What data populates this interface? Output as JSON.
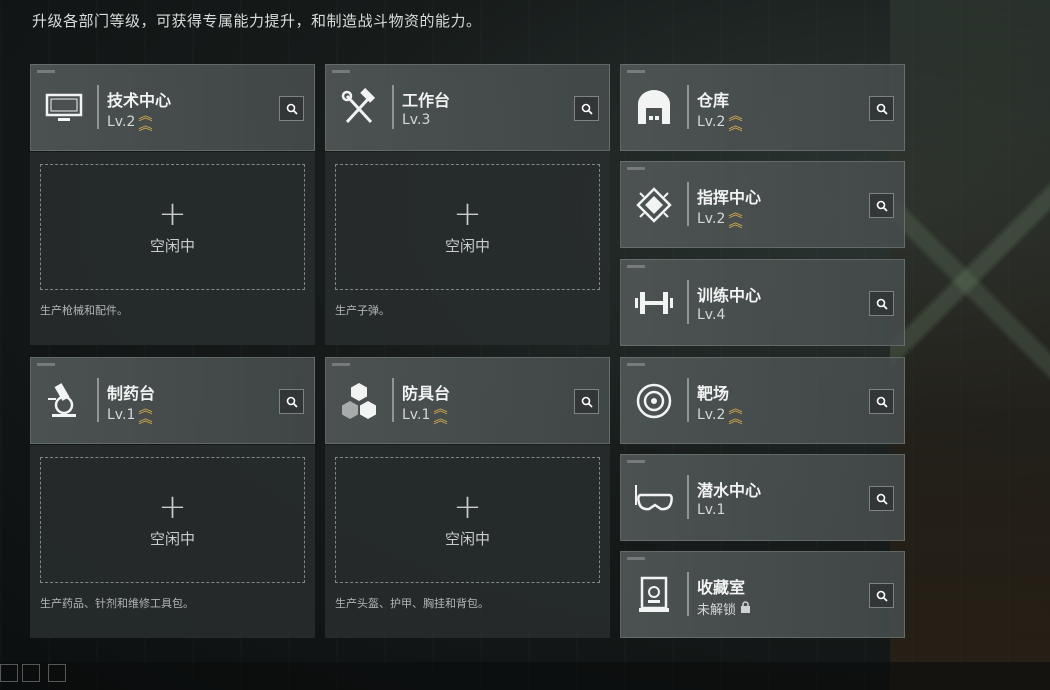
{
  "header": {
    "description": "升级各部门等级，可获得专属能力提升，和制造战斗物资的能力。"
  },
  "colors": {
    "rank_accent": "#e2b550",
    "card_bg": "#50575a",
    "panel_bg": "#282c2d"
  },
  "buildings": {
    "tech": {
      "name": "技术中心",
      "level": "Lv.2",
      "icon": "monitor-icon",
      "has_rank": true
    },
    "workbench": {
      "name": "工作台",
      "level": "Lv.3",
      "icon": "hammer-wrench-icon",
      "has_rank": false
    },
    "pharmacy": {
      "name": "制药台",
      "level": "Lv.1",
      "icon": "microscope-icon",
      "has_rank": true
    },
    "armor": {
      "name": "防具台",
      "level": "Lv.1",
      "icon": "hexagon-cluster-icon",
      "has_rank": true
    },
    "warehouse": {
      "name": "仓库",
      "level": "Lv.2",
      "icon": "warehouse-door-icon",
      "has_rank": true
    },
    "command": {
      "name": "指挥中心",
      "level": "Lv.2",
      "icon": "chip-icon",
      "has_rank": true
    },
    "training": {
      "name": "训练中心",
      "level": "Lv.4",
      "icon": "dumbbell-icon",
      "has_rank": false
    },
    "range": {
      "name": "靶场",
      "level": "Lv.2",
      "icon": "target-icon",
      "has_rank": true
    },
    "diving": {
      "name": "潜水中心",
      "level": "Lv.1",
      "icon": "diving-mask-icon",
      "has_rank": false
    },
    "collection": {
      "name": "收藏室",
      "level": "未解锁",
      "icon": "display-case-icon",
      "locked": true
    }
  },
  "slots": {
    "tech": {
      "plus": "+",
      "status": "空闲中",
      "description": "生产枪械和配件。"
    },
    "workbench": {
      "plus": "+",
      "status": "空闲中",
      "description": "生产子弹。"
    },
    "pharmacy": {
      "plus": "+",
      "status": "空闲中",
      "description": "生产药品、针剂和维修工具包。"
    },
    "armor": {
      "plus": "+",
      "status": "空闲中",
      "description": "生产头盔、护甲、胸挂和背包。"
    }
  }
}
